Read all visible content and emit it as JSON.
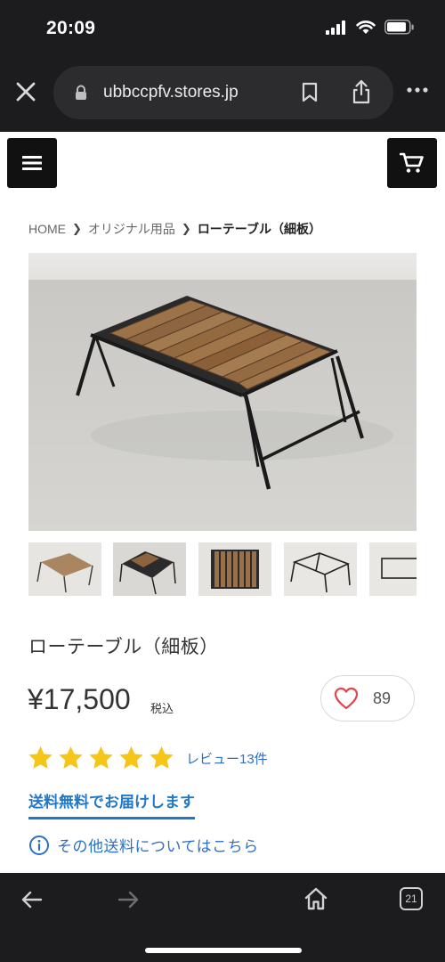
{
  "status": {
    "time": "20:09"
  },
  "browser": {
    "url": "ubbccpfv.stores.jp",
    "tab_count": "21"
  },
  "breadcrumb": {
    "home": "HOME",
    "category": "オリジナル用品",
    "current": "ローテーブル（細板）"
  },
  "product": {
    "title": "ローテーブル（細板）",
    "price": "¥17,500",
    "tax_label": "税込",
    "like_count": "89",
    "rating": 5,
    "rating_max": 5,
    "review_link": "レビュー13件",
    "shipping_label_bold": "送料無料",
    "shipping_label_rest": "でお届けします",
    "other_shipping_link": "その他送料についてはこちら"
  },
  "colors": {
    "star": "#f5c518",
    "link": "#2a6fc9",
    "heart": "#e0474c",
    "header_button": "#111111",
    "chrome": "#1c1c1e"
  },
  "icons": {
    "menu": "hamburger-icon",
    "cart": "cart-icon",
    "like": "heart-icon",
    "info": "info-icon"
  }
}
